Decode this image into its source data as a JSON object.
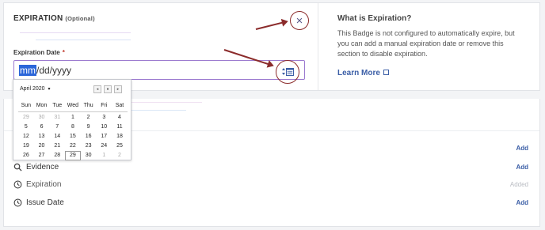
{
  "expiration": {
    "title": "EXPIRATION",
    "optional_tag": "(Optional)",
    "close_glyph": "×",
    "field_label": "Expiration Date",
    "required_mark": "*",
    "date_value_selected": "mm",
    "date_value_rest": "/dd/yyyy"
  },
  "help": {
    "title": "What is Expiration?",
    "body": "This Badge is not configured to automatically expire, but you can add a manual expiration date or remove this section to disable expiration.",
    "link_label": "Learn More"
  },
  "calendar": {
    "month_label": "April 2020",
    "nav_prev": "◂",
    "nav_today": "●",
    "nav_next": "▸",
    "weekdays": [
      "Sun",
      "Mon",
      "Tue",
      "Wed",
      "Thu",
      "Fri",
      "Sat"
    ],
    "weeks": [
      [
        "29",
        "30",
        "31",
        "1",
        "2",
        "3",
        "4"
      ],
      [
        "5",
        "6",
        "7",
        "8",
        "9",
        "10",
        "11"
      ],
      [
        "12",
        "13",
        "14",
        "15",
        "16",
        "17",
        "18"
      ],
      [
        "19",
        "20",
        "21",
        "22",
        "23",
        "24",
        "25"
      ],
      [
        "26",
        "27",
        "28",
        "29",
        "30",
        "1",
        "2"
      ]
    ]
  },
  "sections": [
    {
      "label": "",
      "action": "Add",
      "icon": "none",
      "disabled": false
    },
    {
      "label": "Evidence",
      "action": "Add",
      "icon": "search-icon",
      "disabled": false
    },
    {
      "label": "Expiration",
      "action": "Added",
      "icon": "clock-icon",
      "disabled": true
    },
    {
      "label": "Issue Date",
      "action": "Add",
      "icon": "clock-icon",
      "disabled": false
    }
  ],
  "colors": {
    "accent": "#3b5ea6",
    "annotation": "#8b2b2b",
    "input_focus": "#9c7bd0",
    "selection": "#2b66d9"
  }
}
